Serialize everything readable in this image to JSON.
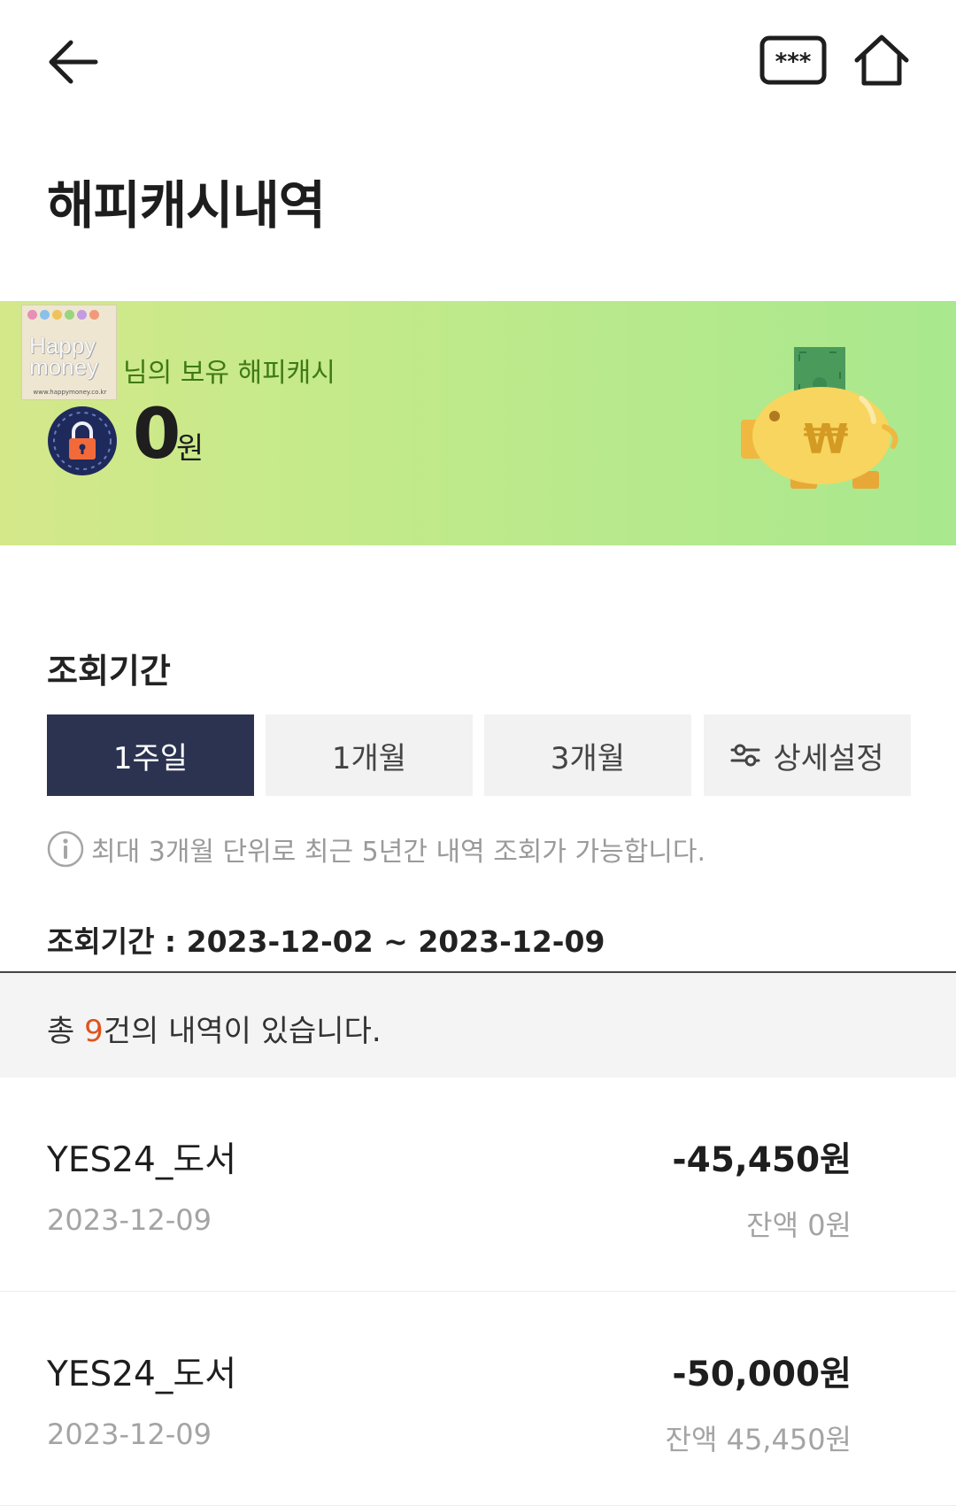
{
  "header": {
    "title": "해피캐시내역"
  },
  "banner": {
    "logo_text_line1": "Happy",
    "logo_text_line2": "money",
    "logo_url": "www.happymoney.co.kr",
    "owner_text": "님의 보유 해피캐시",
    "balance_amount": "0",
    "balance_unit": "원",
    "piggy_currency_symbol": "₩"
  },
  "period": {
    "section_title": "조회기간",
    "tabs": [
      {
        "label": "1주일",
        "active": true
      },
      {
        "label": "1개월",
        "active": false
      },
      {
        "label": "3개월",
        "active": false
      },
      {
        "label": "상세설정",
        "active": false,
        "icon": "slider-settings-icon"
      }
    ],
    "info_text": "최대 3개월 단위로 최근 5년간 내역 조회가 가능합니다.",
    "range_label": "조회기간 : 2023-12-02 ~ 2023-12-09"
  },
  "summary": {
    "prefix": "총 ",
    "count": "9",
    "suffix": "건의 내역이 있습니다."
  },
  "transactions": [
    {
      "merchant": "YES24_도서",
      "amount": "-45,450원",
      "date": "2023-12-09",
      "balance": "잔액 0원"
    },
    {
      "merchant": "YES24_도서",
      "amount": "-50,000원",
      "date": "2023-12-09",
      "balance": "잔액 45,450원"
    }
  ],
  "colors": {
    "active_tab": "#2b3350",
    "count_highlight": "#e0531e",
    "banner_text": "#3e7a16",
    "banner_gradient_start": "#d4e88a",
    "banner_gradient_end": "#a9e88e"
  }
}
